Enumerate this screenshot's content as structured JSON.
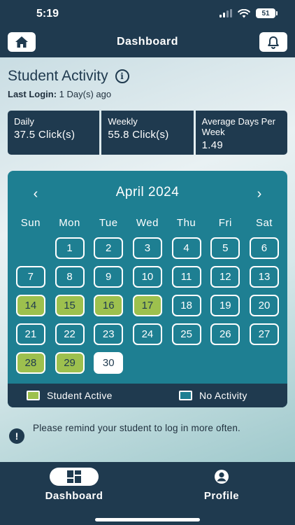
{
  "status_bar": {
    "time": "5:19",
    "battery": "51"
  },
  "header": {
    "title": "Dashboard"
  },
  "activity": {
    "title": "Student Activity",
    "last_login_label": "Last Login:",
    "last_login_value": "1 Day(s) ago"
  },
  "stats": [
    {
      "label": "Daily",
      "value": "37.5 Click(s)"
    },
    {
      "label": "Weekly",
      "value": "55.8 Click(s)"
    },
    {
      "label": "Average Days Per Week",
      "value": "1.49"
    }
  ],
  "calendar": {
    "month": "April 2024",
    "prev_arrow": "‹",
    "next_arrow": "›",
    "weekdays": [
      "Sun",
      "Mon",
      "Tue",
      "Wed",
      "Thu",
      "Fri",
      "Sat"
    ],
    "weeks": [
      [
        null,
        "1",
        "2",
        "3",
        "4",
        "5",
        "6"
      ],
      [
        "7",
        "8",
        "9",
        "10",
        "11",
        "12",
        "13"
      ],
      [
        "14",
        "15",
        "16",
        "17",
        "18",
        "19",
        "20"
      ],
      [
        "21",
        "22",
        "23",
        "24",
        "25",
        "26",
        "27"
      ],
      [
        "28",
        "29",
        "30",
        null,
        null,
        null,
        null
      ]
    ],
    "active_days": [
      "14",
      "15",
      "16",
      "17",
      "28",
      "29"
    ],
    "today": "30",
    "legend_active": "Student Active",
    "legend_none": "No Activity",
    "colors": {
      "active": "#9dc04e",
      "calendar_bg": "#1e7f92",
      "navy": "#1f3a4f"
    }
  },
  "reminder": {
    "text": "Please remind your student to log in more often."
  },
  "bottom_nav": {
    "dashboard_label": "Dashboard",
    "profile_label": "Profile"
  },
  "icons": {
    "home": "home-icon",
    "bell": "bell-icon",
    "info": "info-icon",
    "alert": "exclamation-icon",
    "dashboard": "grid-icon",
    "profile": "user-icon"
  }
}
